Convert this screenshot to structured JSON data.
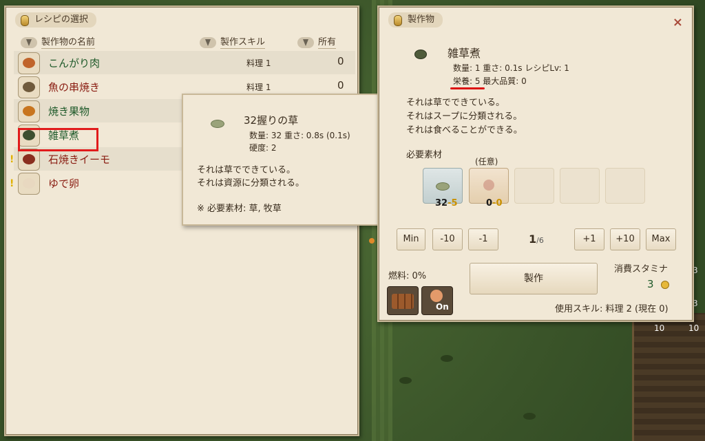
{
  "recipe_panel": {
    "title": "レシピの選択",
    "columns": {
      "name": "製作物の名前",
      "skill": "製作スキル",
      "owned": "所有"
    },
    "rows": [
      {
        "name": "こんがり肉",
        "skill": "料理 1",
        "owned": "0",
        "name_color": "green",
        "warn": "",
        "icon_color": "#c0642b"
      },
      {
        "name": "魚の串焼き",
        "skill": "料理 1",
        "owned": "0",
        "name_color": "red",
        "warn": "",
        "icon_color": "#6f5a3c"
      },
      {
        "name": "焼き果物",
        "skill": "",
        "owned": "",
        "name_color": "green",
        "warn": "",
        "icon_color": "#c8751e"
      },
      {
        "name": "雑草煮",
        "skill": "",
        "owned": "",
        "name_color": "green",
        "warn": "",
        "icon_color": "#3d5030"
      },
      {
        "name": "石焼きイーモ",
        "skill": "",
        "owned": "",
        "name_color": "red",
        "warn": "!",
        "icon_color": "#8a2e1e"
      },
      {
        "name": "ゆで卵",
        "skill": "",
        "owned": "",
        "name_color": "red",
        "warn": "!",
        "icon_color": "#e8d8c0"
      }
    ]
  },
  "tooltip": {
    "name": "32握りの草",
    "stat1": "数量: 32  重さ: 0.8s (0.1s)",
    "stat2": "硬度: 2",
    "desc1": "それは草でできている。",
    "desc2": "それは資源に分類される。",
    "materials": "※ 必要素材: 草, 牧草"
  },
  "craft_panel": {
    "title": "製作物",
    "close": "×",
    "item_name": "雑草煮",
    "stat1": "数量: 1  重さ: 0.1s  レシピLv: 1",
    "stat2": "栄養: 5  最大品質: 0",
    "desc1": "それは草でできている。",
    "desc2": "それはスープに分類される。",
    "desc3": "それは食べることができる。",
    "materials_label": "必要素材",
    "optional_label": "(任意)",
    "slot1_count": "32",
    "slot1_need": "-5",
    "slot2_count": "0",
    "slot2_need": "-0",
    "buttons": [
      "Min",
      "-10",
      "-1",
      "+1",
      "+10",
      "Max"
    ],
    "quantity": "1",
    "quantity_max": "/6",
    "fuel": "燃料: 0%",
    "craft": "製作",
    "stamina_label": "消費スタミナ",
    "stamina_value": "3",
    "toggle": "On",
    "skill_info": "使用スキル: 料理 2 (現在 0)"
  },
  "world": {
    "hud_numbers": [
      "3",
      "3",
      "10",
      "10"
    ]
  }
}
